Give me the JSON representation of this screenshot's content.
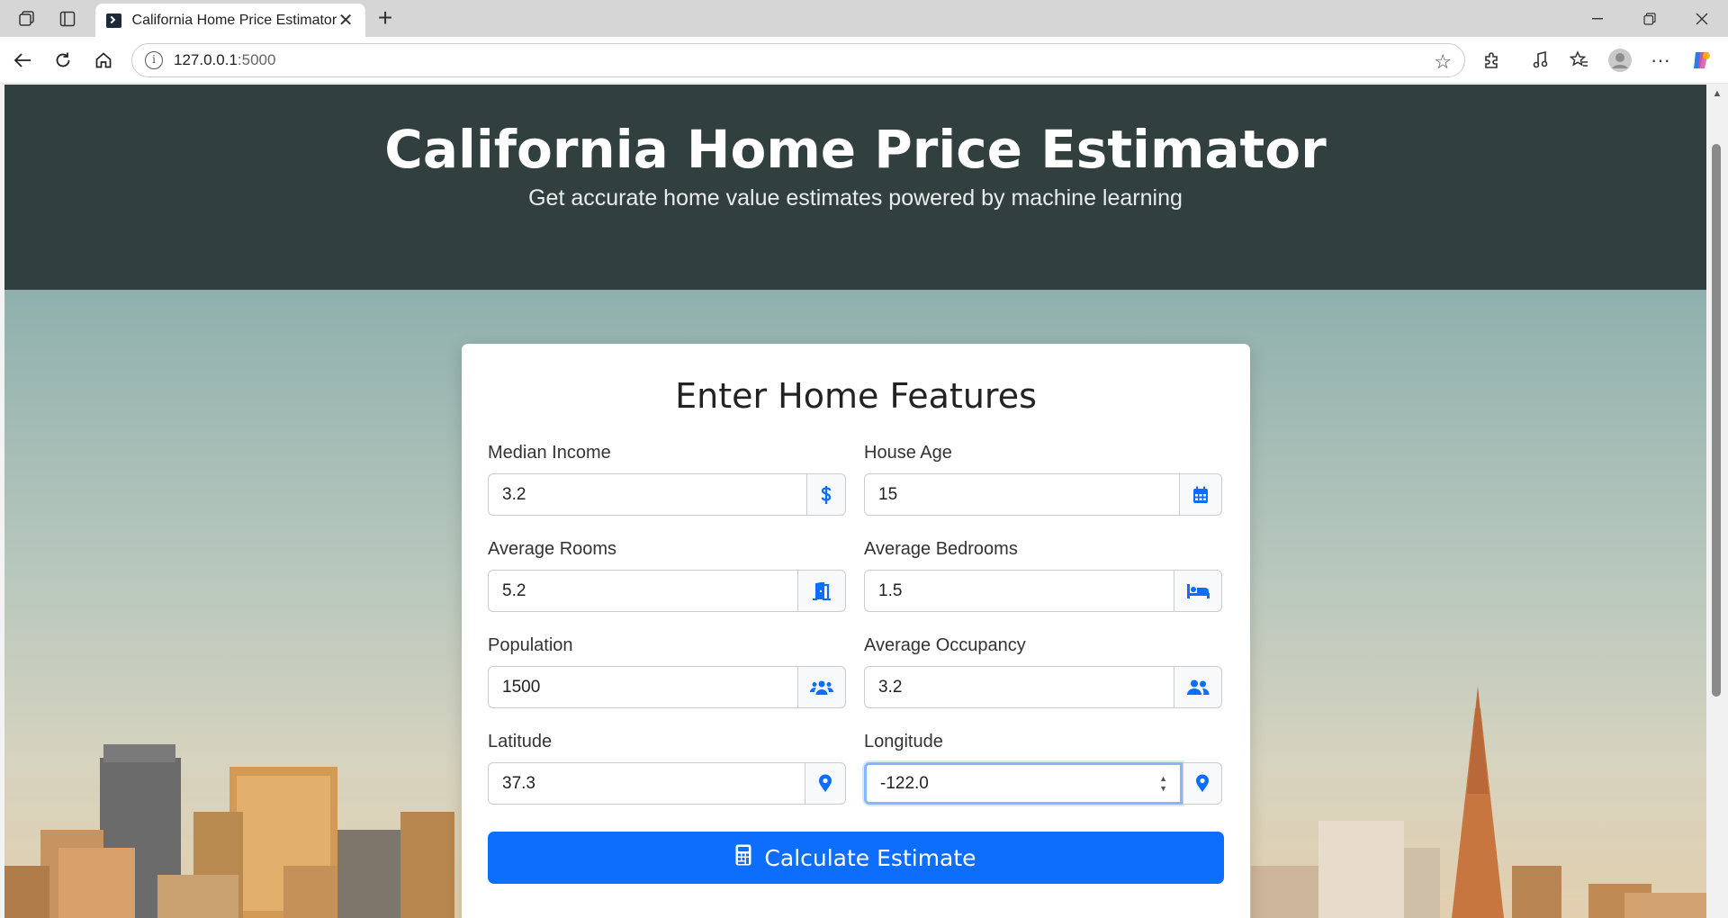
{
  "browser": {
    "tab_title": "California Home Price Estimator",
    "url_host": "127.0.0.1",
    "url_port": ":5000"
  },
  "hero": {
    "title": "California Home Price Estimator",
    "subtitle": "Get accurate home value estimates powered by machine learning"
  },
  "form": {
    "heading": "Enter Home Features",
    "fields": [
      {
        "label": "Median Income",
        "value": "3.2",
        "icon": "dollar-icon"
      },
      {
        "label": "House Age",
        "value": "15",
        "icon": "calendar-icon"
      },
      {
        "label": "Average Rooms",
        "value": "5.2",
        "icon": "door-open-icon"
      },
      {
        "label": "Average Bedrooms",
        "value": "1.5",
        "icon": "bed-icon"
      },
      {
        "label": "Population",
        "value": "1500",
        "icon": "users-icon"
      },
      {
        "label": "Average Occupancy",
        "value": "3.2",
        "icon": "user-friends-icon"
      },
      {
        "label": "Latitude",
        "value": "37.3",
        "icon": "map-marker-icon"
      },
      {
        "label": "Longitude",
        "value": "-122.0",
        "icon": "map-marker-icon"
      }
    ],
    "submit_label": "Calculate Estimate"
  },
  "colors": {
    "accent": "#0d6efd",
    "hero_bg": "#31403f"
  }
}
